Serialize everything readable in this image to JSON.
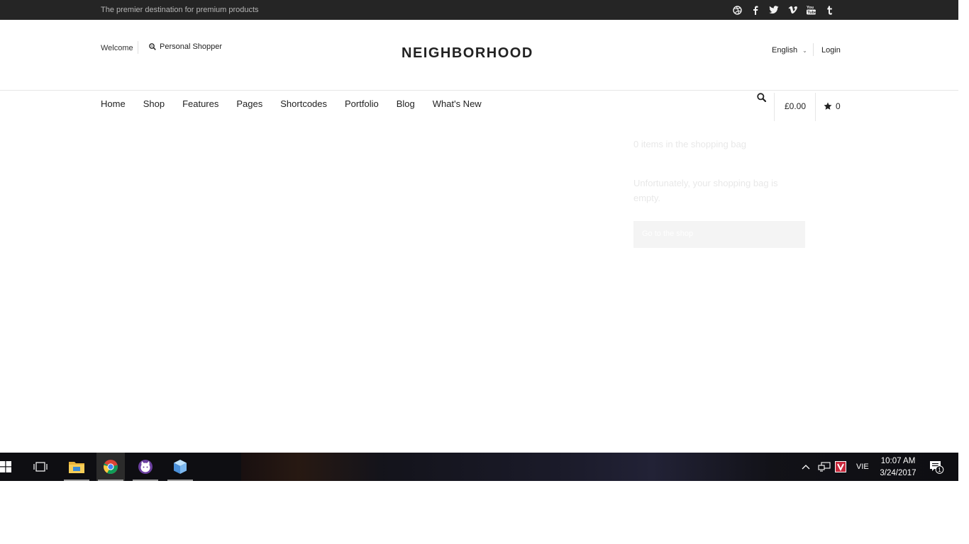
{
  "topbar": {
    "tagline": "The premier destination for premium products",
    "social_icons": [
      "dribbble-icon",
      "facebook-icon",
      "twitter-icon",
      "vimeo-icon",
      "youtube-icon",
      "tumblr-icon"
    ]
  },
  "header": {
    "welcome": "Welcome",
    "personal_shopper": "Personal Shopper",
    "logo": "NEIGHBORHOOD",
    "language": "English",
    "login": "Login"
  },
  "nav": {
    "items": [
      "Home",
      "Shop",
      "Features",
      "Pages",
      "Shortcodes",
      "Portfolio",
      "Blog",
      "What's New"
    ]
  },
  "cart": {
    "amount": "£0.00",
    "wishlist_count": "0"
  },
  "bag_dropdown": {
    "count_text": "0 items in the shopping bag",
    "empty_text": "Unfortunately, your shopping bag is empty.",
    "button": "Go to the shop"
  },
  "taskbar": {
    "language": "VIE",
    "time": "10:07 AM",
    "date": "3/24/2017",
    "notification_count": "1"
  }
}
